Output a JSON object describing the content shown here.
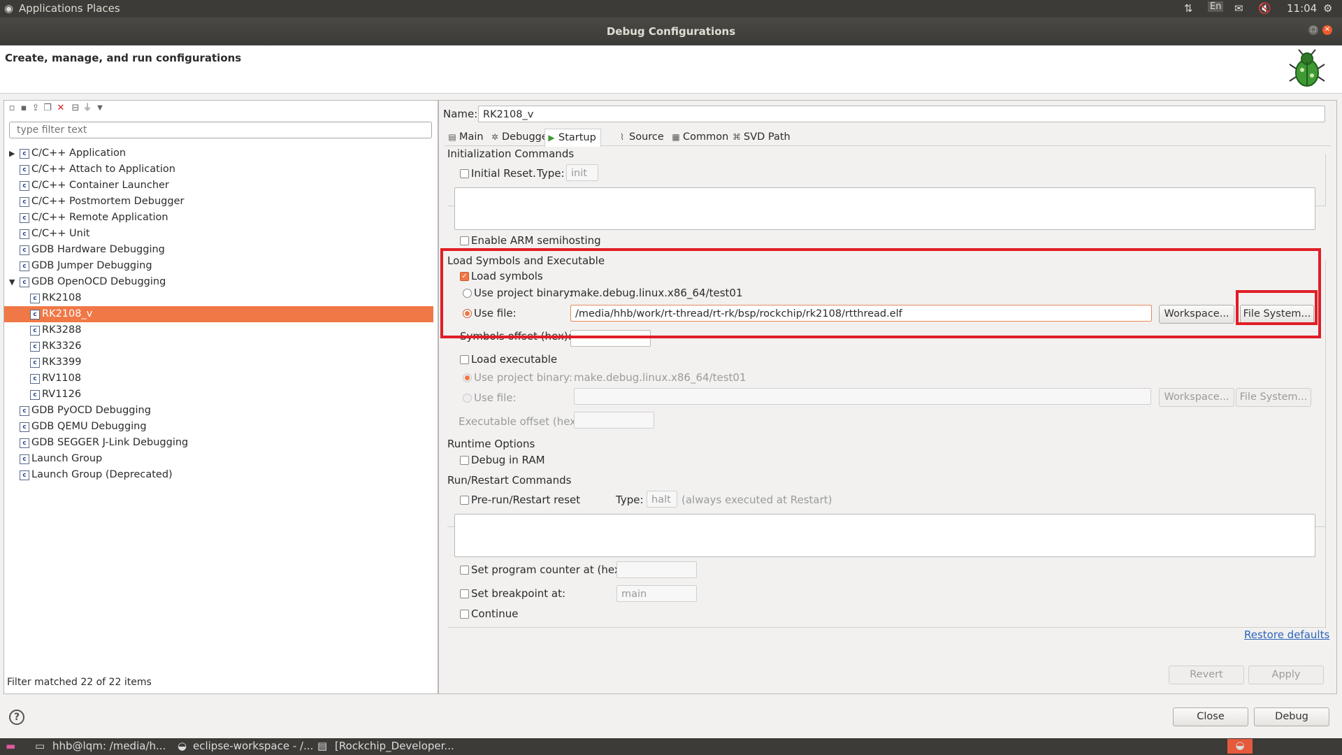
{
  "topbar": {
    "applications": "Applications",
    "places": "Places",
    "lang": "En",
    "time": "11:04"
  },
  "window": {
    "title": "Debug Configurations"
  },
  "header": {
    "heading": "Create, manage, and run configurations"
  },
  "left": {
    "filter_placeholder": "type filter text",
    "tree": [
      {
        "label": "C/C++ Application",
        "level": 0,
        "expander": "▶"
      },
      {
        "label": "C/C++ Attach to Application",
        "level": 0
      },
      {
        "label": "C/C++ Container Launcher",
        "level": 0
      },
      {
        "label": "C/C++ Postmortem Debugger",
        "level": 0
      },
      {
        "label": "C/C++ Remote Application",
        "level": 0
      },
      {
        "label": "C/C++ Unit",
        "level": 0
      },
      {
        "label": "GDB Hardware Debugging",
        "level": 0
      },
      {
        "label": "GDB Jumper Debugging",
        "level": 0
      },
      {
        "label": "GDB OpenOCD Debugging",
        "level": 0,
        "expander": "▼"
      },
      {
        "label": "RK2108",
        "level": 1
      },
      {
        "label": "RK2108_v",
        "level": 1,
        "selected": true
      },
      {
        "label": "RK3288",
        "level": 1
      },
      {
        "label": "RK3326",
        "level": 1
      },
      {
        "label": "RK3399",
        "level": 1
      },
      {
        "label": "RV1108",
        "level": 1
      },
      {
        "label": "RV1126",
        "level": 1
      },
      {
        "label": "GDB PyOCD Debugging",
        "level": 0
      },
      {
        "label": "GDB QEMU Debugging",
        "level": 0
      },
      {
        "label": "GDB SEGGER J-Link Debugging",
        "level": 0
      },
      {
        "label": "Launch Group",
        "level": 0
      },
      {
        "label": "Launch Group (Deprecated)",
        "level": 0
      }
    ],
    "status": "Filter matched 22 of 22 items"
  },
  "right": {
    "name_label": "Name:",
    "name_value": "RK2108_v",
    "tabs": [
      "Main",
      "Debugger",
      "Startup",
      "Source",
      "Common",
      "SVD Path"
    ],
    "init": {
      "title": "Initialization Commands",
      "initial_reset": "Initial Reset.",
      "type_label": "Type:",
      "type_value": "init",
      "semihosting": "Enable ARM semihosting"
    },
    "load": {
      "title": "Load Symbols and Executable",
      "load_symbols": "Load symbols",
      "use_project_binary": "Use project binary:",
      "project_binary_value": "make.debug.linux.x86_64/test01",
      "use_file": "Use file:",
      "file_value": "/media/hhb/work/rt-thread/rt-rk/bsp/rockchip/rk2108/rtthread.elf",
      "workspace_btn": "Workspace...",
      "filesystem_btn": "File System...",
      "symbols_offset": "Symbols offset (hex):",
      "load_executable": "Load executable",
      "exec_project_binary_value": "make.debug.linux.x86_64/test01",
      "executable_offset": "Executable offset (hex):"
    },
    "runtime": {
      "title": "Runtime Options",
      "debug_in_ram": "Debug in RAM"
    },
    "run": {
      "title": "Run/Restart Commands",
      "pre_run": "Pre-run/Restart reset",
      "type_label": "Type:",
      "type_value": "halt",
      "note": "(always executed at Restart)",
      "set_pc": "Set program counter at (hex):",
      "set_bp": "Set breakpoint at:",
      "bp_value": "main",
      "continue": "Continue"
    },
    "restore_defaults": "Restore defaults",
    "revert": "Revert",
    "apply": "Apply"
  },
  "footer": {
    "help": "?",
    "close": "Close",
    "debug": "Debug"
  },
  "taskbar": {
    "items": [
      "hhb@lqm: /media/h...",
      "eclipse-workspace - /...",
      "[Rockchip_Developer..."
    ]
  },
  "colors": {
    "selection": "#f07746",
    "highlight_box": "#e01e27",
    "panel_bg": "#3c3b37"
  }
}
